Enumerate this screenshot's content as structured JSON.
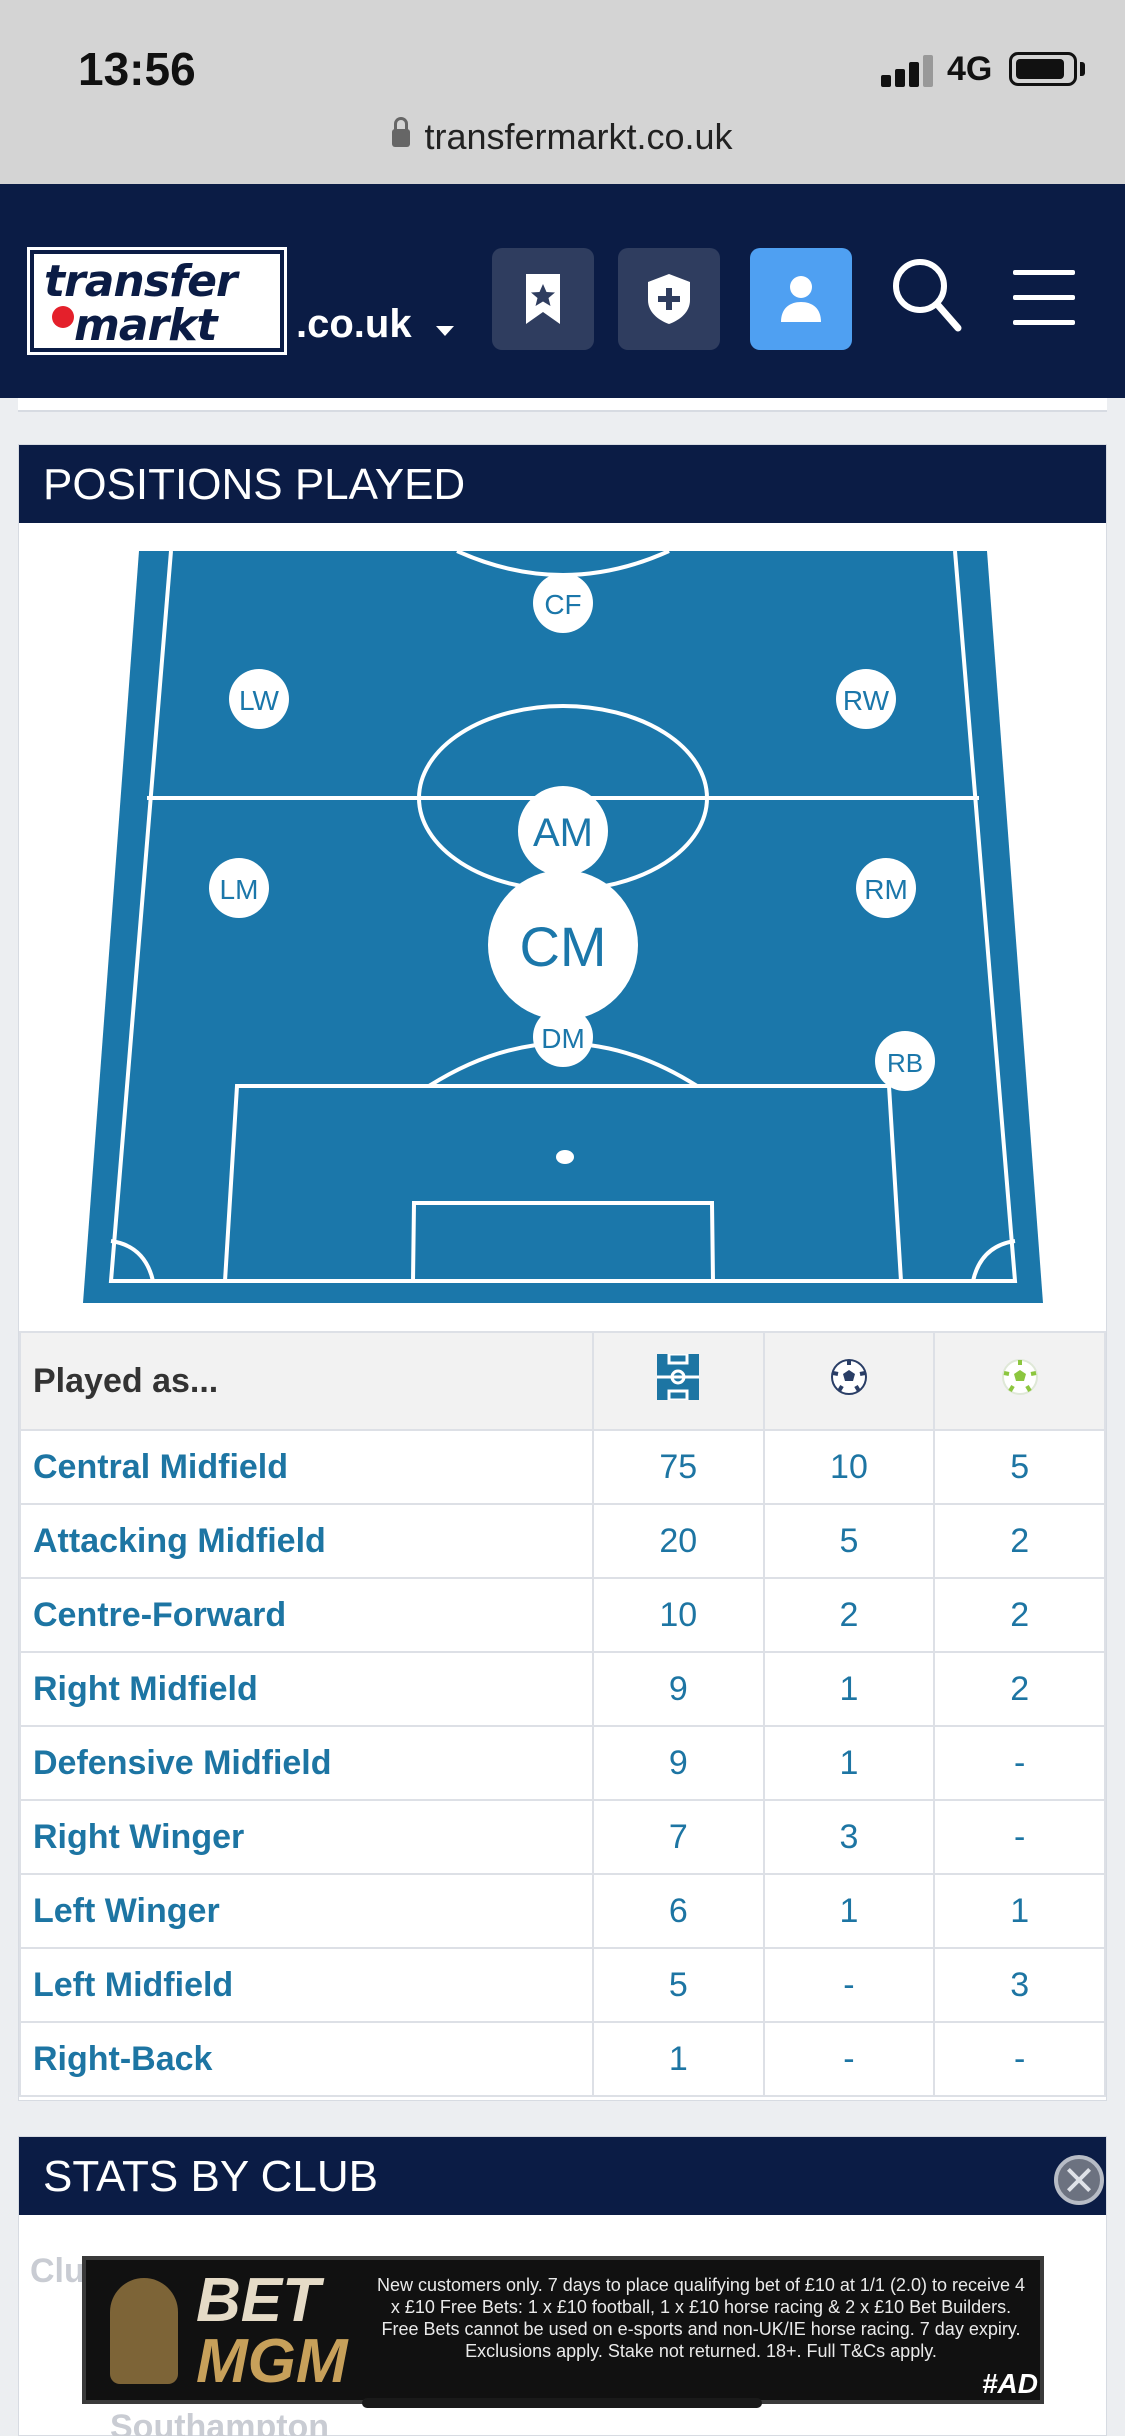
{
  "status_bar": {
    "time": "13:56",
    "network": "4G"
  },
  "browser": {
    "url": "transfermarkt.co.uk"
  },
  "header": {
    "logo_line1": "transfer",
    "logo_line2": "markt",
    "domain": ".co.uk",
    "icons": [
      "bookmark-star-icon",
      "shield-plus-icon",
      "user-icon",
      "search-icon",
      "menu-icon"
    ],
    "colors": {
      "navy": "#0b1c45",
      "user_button": "#4fa0f2",
      "link_blue": "#1d75a3",
      "pitch": "#1b77aa"
    }
  },
  "positions_section": {
    "title": "POSITIONS PLAYED",
    "pitch_markers": [
      {
        "label": "CF",
        "size": "small"
      },
      {
        "label": "LW",
        "size": "small"
      },
      {
        "label": "RW",
        "size": "small"
      },
      {
        "label": "AM",
        "size": "medium"
      },
      {
        "label": "LM",
        "size": "small"
      },
      {
        "label": "RM",
        "size": "small"
      },
      {
        "label": "CM",
        "size": "large"
      },
      {
        "label": "DM",
        "size": "small"
      },
      {
        "label": "RB",
        "size": "small"
      }
    ],
    "table": {
      "header": "Played as...",
      "column_icons": [
        "pitch-icon",
        "football-icon",
        "assist-football-icon"
      ],
      "rows": [
        {
          "position": "Central Midfield",
          "apps": "75",
          "goals": "10",
          "assists": "5"
        },
        {
          "position": "Attacking Midfield",
          "apps": "20",
          "goals": "5",
          "assists": "2"
        },
        {
          "position": "Centre-Forward",
          "apps": "10",
          "goals": "2",
          "assists": "2"
        },
        {
          "position": "Right Midfield",
          "apps": "9",
          "goals": "1",
          "assists": "2"
        },
        {
          "position": "Defensive Midfield",
          "apps": "9",
          "goals": "1",
          "assists": "-"
        },
        {
          "position": "Right Winger",
          "apps": "7",
          "goals": "3",
          "assists": "-"
        },
        {
          "position": "Left Winger",
          "apps": "6",
          "goals": "1",
          "assists": "1"
        },
        {
          "position": "Left Midfield",
          "apps": "5",
          "goals": "-",
          "assists": "3"
        },
        {
          "position": "Right-Back",
          "apps": "1",
          "goals": "-",
          "assists": "-"
        }
      ]
    }
  },
  "stats_section": {
    "title": "STATS BY CLUB",
    "partial_header": "Clu",
    "partial_row": "Southampton"
  },
  "ad": {
    "brand_line1": "BET",
    "brand_line2": "MGM",
    "text": "New customers only. 7 days to place qualifying bet of £10 at 1/1 (2.0) to receive 4 x £10 Free Bets: 1 x £10 football, 1 x £10 horse racing & 2 x £10 Bet Builders. Free Bets cannot be used on e-sports and non-UK/IE horse racing. 7 day expiry. Exclusions apply. Stake not returned. 18+. Full T&Cs apply.",
    "tag": "#AD"
  }
}
